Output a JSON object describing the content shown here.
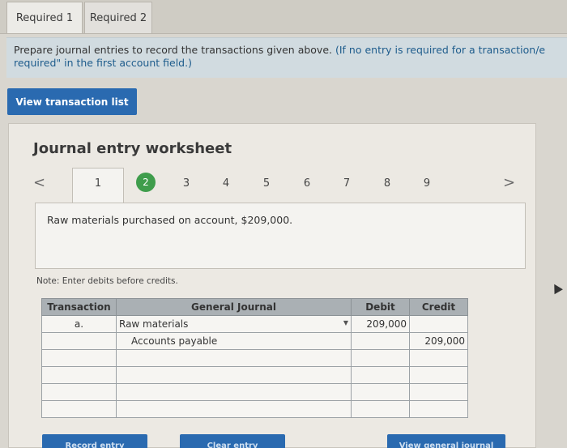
{
  "tabs": [
    {
      "label": "Required 1"
    },
    {
      "label": "Required 2"
    }
  ],
  "instructions": {
    "main": "Prepare journal entries to record the transactions given above.",
    "note": "(If no entry is required for a transaction/e",
    "line2": "required\" in the first account field.)"
  },
  "view_transaction_btn": "View transaction list",
  "worksheet": {
    "title": "Journal entry worksheet",
    "steps": [
      "1",
      "2",
      "3",
      "4",
      "5",
      "6",
      "7",
      "8",
      "9"
    ],
    "active_step": "2",
    "nav_left": "<",
    "nav_right": ">",
    "description": "Raw materials purchased on account, $209,000.",
    "note": "Note: Enter debits before credits."
  },
  "table": {
    "headers": {
      "transaction": "Transaction",
      "general_journal": "General Journal",
      "debit": "Debit",
      "credit": "Credit"
    },
    "rows": [
      {
        "transaction": "a.",
        "account": "Raw materials",
        "debit": "209,000",
        "credit": ""
      },
      {
        "transaction": "",
        "account": "Accounts payable",
        "debit": "",
        "credit": "209,000"
      },
      {
        "transaction": "",
        "account": "",
        "debit": "",
        "credit": ""
      },
      {
        "transaction": "",
        "account": "",
        "debit": "",
        "credit": ""
      },
      {
        "transaction": "",
        "account": "",
        "debit": "",
        "credit": ""
      },
      {
        "transaction": "",
        "account": "",
        "debit": "",
        "credit": ""
      }
    ]
  },
  "bottom_buttons": {
    "record": "Record entry",
    "clear": "Clear entry",
    "view_journal": "View general journal"
  },
  "colors": {
    "primary_button": "#2a6ab0",
    "active_step": "#3f9d4c",
    "instruction_bg": "#d1dbe0",
    "instruction_highlight": "#1e5c8c"
  }
}
